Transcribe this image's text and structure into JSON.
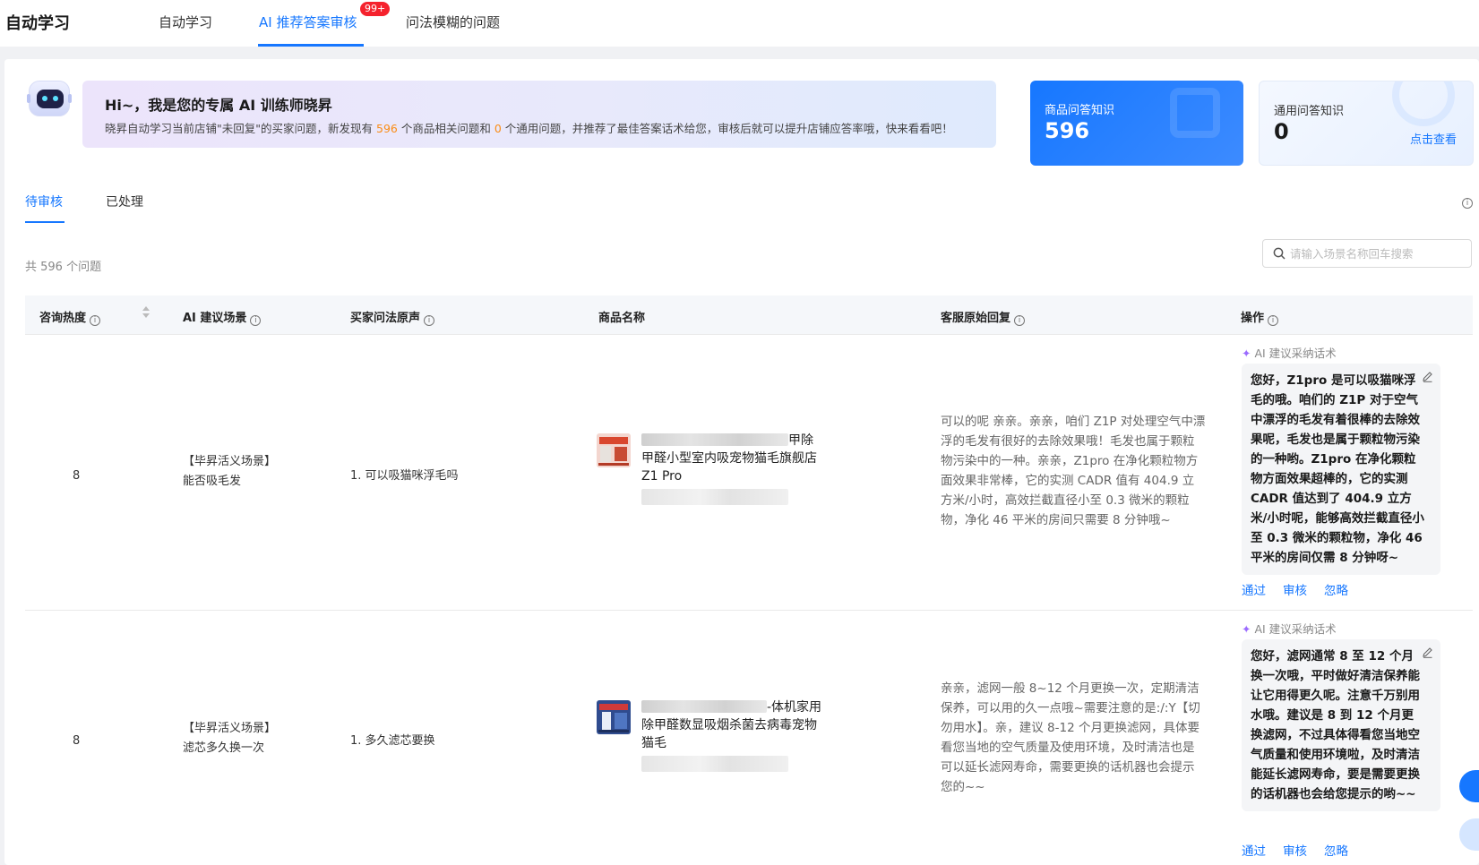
{
  "app": {
    "title": "自动学习"
  },
  "nav": {
    "tabs": [
      {
        "label": "自动学习"
      },
      {
        "label": "AI 推荐答案审核",
        "badge": "99+"
      },
      {
        "label": "问法模糊的问题"
      }
    ]
  },
  "banner": {
    "title": "Hi~，我是您的专属 AI 训练师晓昇",
    "desc_prefix": "晓昇自动学习当前店铺\"未回复\"的买家问题，新发现有",
    "product_count": "596",
    "desc_mid": "个商品相关问题和",
    "general_count": "0",
    "desc_suffix": "个通用问题，并推荐了最佳答案话术给您，审核后就可以提升店铺应答率哦，快来看看吧！"
  },
  "cards": {
    "product": {
      "label": "商品问答知识",
      "value": "596"
    },
    "general": {
      "label": "通用问答知识",
      "value": "0",
      "link": "点击查看"
    }
  },
  "subtabs": [
    {
      "label": "待审核"
    },
    {
      "label": "已处理"
    }
  ],
  "total_text": "共 596 个问题",
  "search": {
    "placeholder": "请输入场景名称回车搜索"
  },
  "table": {
    "columns": [
      "咨询热度",
      "AI 建议场景",
      "买家问法原声",
      "商品名称",
      "客服原始回复",
      "操作"
    ],
    "ai_label": "AI 建议采纳话术",
    "actions": {
      "pass": "通过",
      "review": "审核",
      "ignore": "忽略"
    },
    "rows": [
      {
        "heat": "8",
        "scene_tag": "【毕昇活义场景】",
        "scene_name": "能否吸毛发",
        "buyer_voice": "1. 可以吸猫咪浮毛吗",
        "product_name_tail": "甲除甲",
        "product_name_rest": "醛小型室内吸宠物猫毛旗舰店Z1 Pro",
        "original_reply": "可以的呢 亲亲。亲亲，咱们 Z1P 对处理空气中漂浮的毛发有很好的去除效果哦！毛发也属于颗粒物污染中的一种。亲亲，Z1pro 在净化颗粒物方面效果非常棒，它的实测 CADR 值有 404.9 立方米/小时，高效拦截直径小至 0.3 微米的颗粒物，净化 46 平米的房间只需要 8 分钟哦~",
        "ai_suggestion": "您好，Z1pro 是可以吸猫咪浮毛的哦。咱们的 Z1P 对于空气中漂浮的毛发有着很棒的去除效果呢，毛发也是属于颗粒物污染的一种哟。Z1pro 在净化颗粒物方面效果超棒的，它的实测 CADR 值达到了 404.9 立方米/小时呢，能够高效拦截直径小至 0.3 微米的颗粒物，净化 46 平米的房间仅需 8 分钟呀~"
      },
      {
        "heat": "8",
        "scene_tag": "【毕昇活义场景】",
        "scene_name": "滤芯多久换一次",
        "buyer_voice": "1. 多久滤芯要换",
        "product_name_tail": "-体机家用",
        "product_name_rest": "除甲醛数显吸烟杀菌去病毒宠物猫毛",
        "original_reply": "亲亲，滤网一般 8~12 个月更换一次，定期清洁保养，可以用的久一点哦~需要注意的是:/:Y【切勿用水】。亲，建议 8-12 个月更换滤网，具体要看您当地的空气质量及使用环境，及时清洁也是可以延长滤网寿命，需要更换的话机器也会提示您的~~",
        "ai_suggestion": "您好，滤网通常 8 至 12 个月换一次哦，平时做好清洁保养能让它用得更久呢。注意千万别用水哦。建议是 8 到 12 个月更换滤网，不过具体得看您当地空气质量和使用环境啦，及时清洁能延长滤网寿命，要是需要更换的话机器也会给您提示的哟~~"
      }
    ]
  }
}
